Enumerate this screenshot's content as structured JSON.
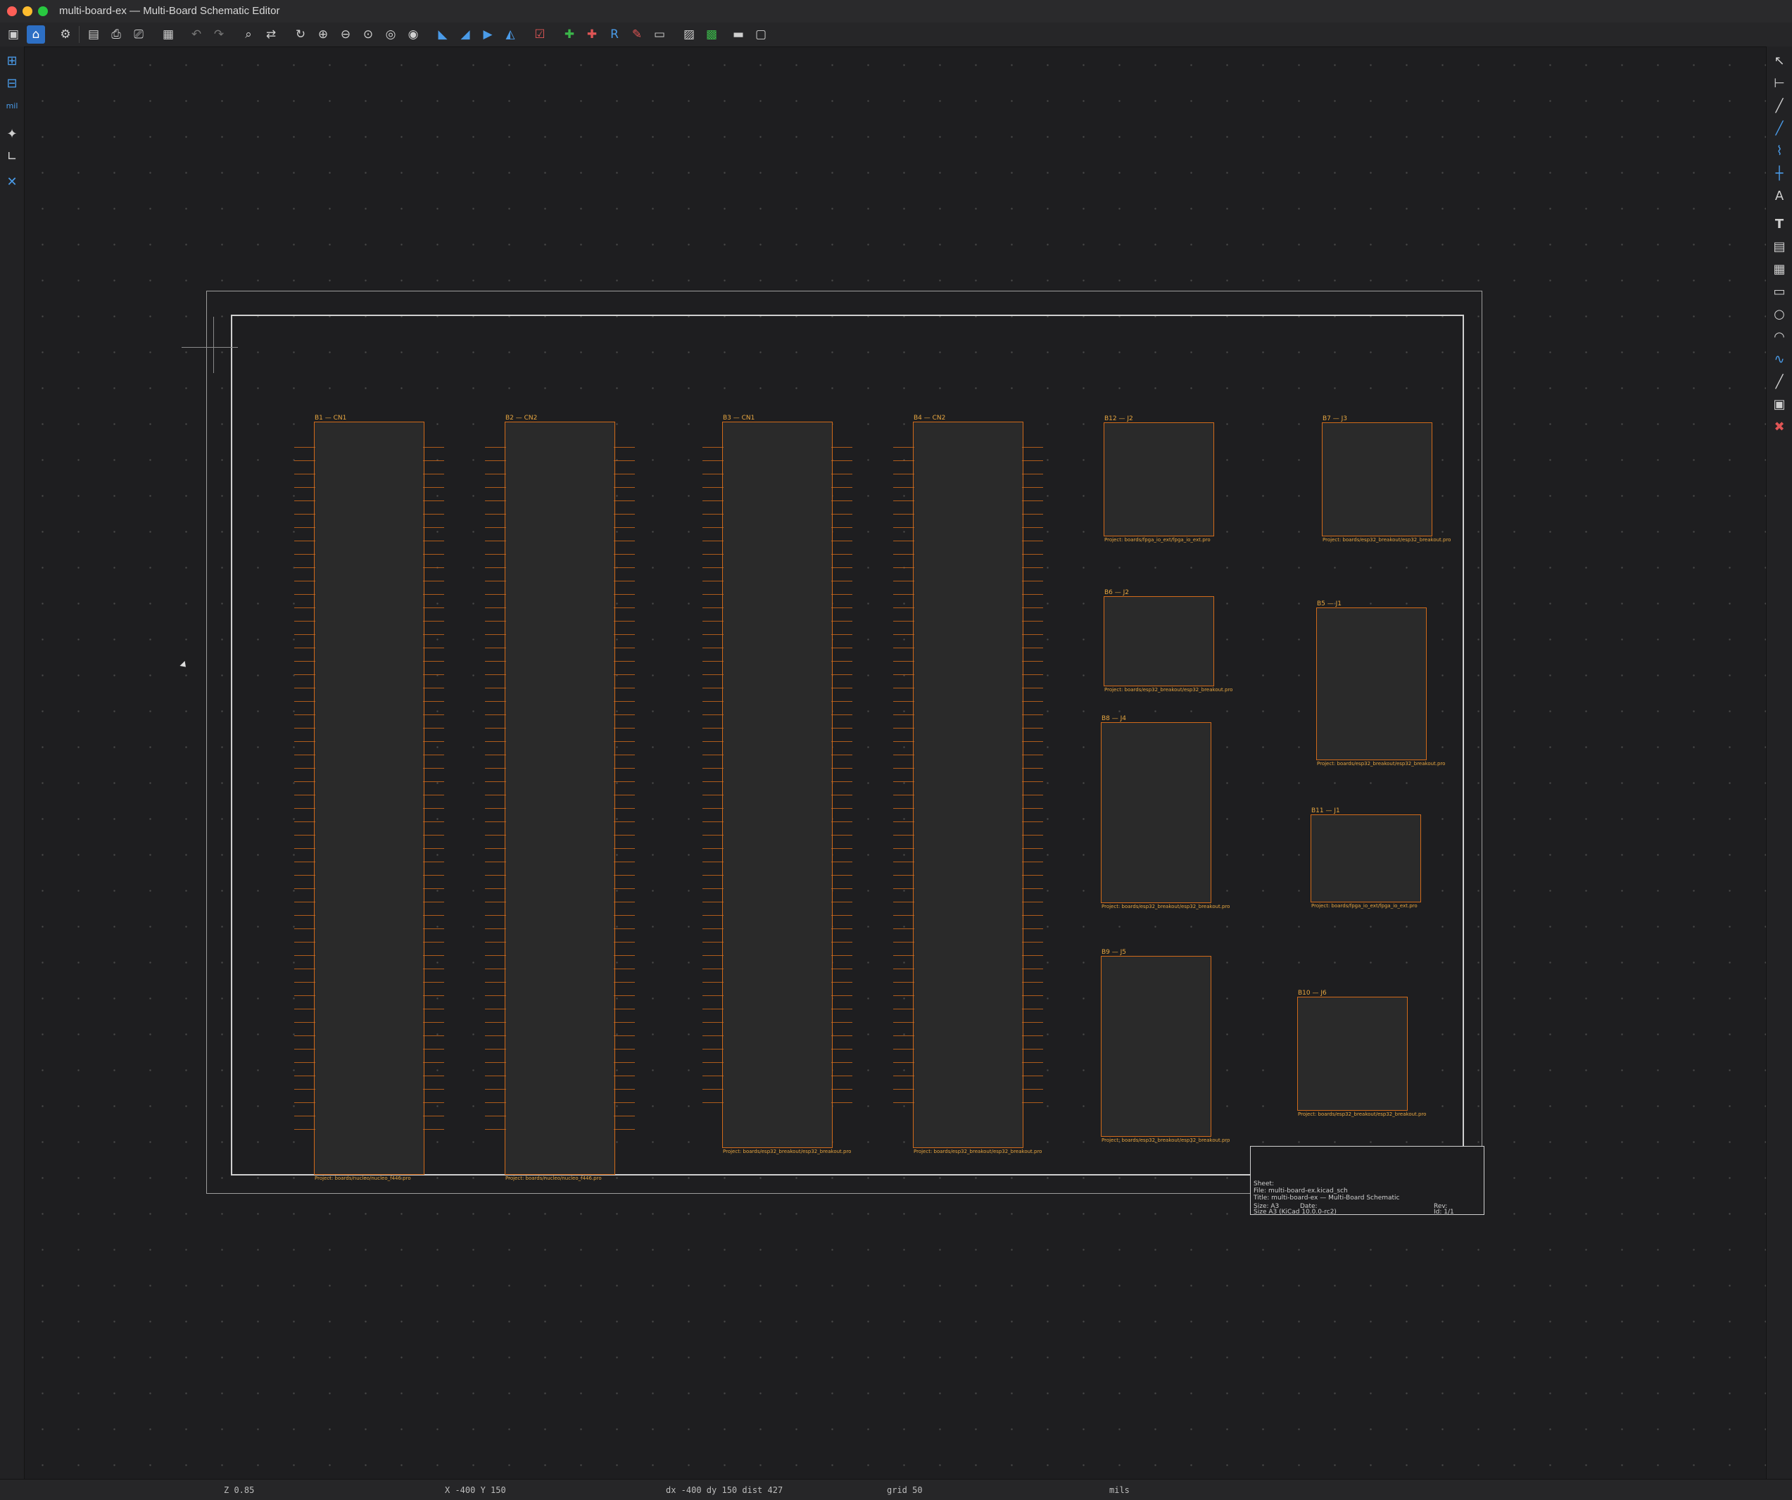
{
  "window": {
    "title": "multi-board-ex — Multi-Board Schematic Editor"
  },
  "toolbar_icons": [
    "save-icon",
    "app-icon",
    "schematic-setup-icon",
    "page-setup-icon",
    "print-icon",
    "plot-icon",
    "paste-icon",
    "undo-icon",
    "redo-icon",
    "find-icon",
    "find-replace-icon",
    "refresh-icon",
    "zoom-in-icon",
    "zoom-out-icon",
    "zoom-fit-icon",
    "zoom-objects-icon",
    "zoom-selection-icon",
    "rotate-ccw-icon",
    "rotate-cw-icon",
    "mirror-v-icon",
    "mirror-h-icon",
    "erc-icon",
    "symbol-editor-icon",
    "symbol-browser-icon",
    "annotate-icon",
    "bom-icon",
    "netlist-icon",
    "pcb-icon",
    "scripting-icon",
    "console-icon"
  ],
  "sheet": {
    "boards": [
      {
        "title": "B1 — CN1",
        "project": "Project: boards/nucleo/nucleo_f446.pro"
      },
      {
        "title": "B2 — CN2",
        "project": "Project: boards/nucleo/nucleo_f446.pro"
      },
      {
        "title": "B3 — CN1",
        "project": "Project: boards/esp32_breakout/esp32_breakout.pro"
      },
      {
        "title": "B4 — CN2",
        "project": "Project: boards/esp32_breakout/esp32_breakout.pro"
      },
      {
        "title": "B12 — J2",
        "project": "Project: boards/fpga_io_ext/fpga_io_ext.pro"
      },
      {
        "title": "B7 — J3",
        "project": "Project: boards/esp32_breakout/esp32_breakout.pro"
      },
      {
        "title": "B6 — J2",
        "project": "Project: boards/esp32_breakout/esp32_breakout.pro"
      },
      {
        "title": "B5 — J1",
        "project": "Project: boards/esp32_breakout/esp32_breakout.pro"
      },
      {
        "title": "B8 — J4",
        "project": "Project: boards/esp32_breakout/esp32_breakout.pro"
      },
      {
        "title": "B11 — J1",
        "project": "Project: boards/fpga_io_ext/fpga_io_ext.pro"
      },
      {
        "title": "B9 — J5",
        "project": "Project: boards/esp32_breakout/esp32_breakout.pro"
      },
      {
        "title": "B10 — J6",
        "project": "Project: boards/esp32_breakout/esp32_breakout.pro"
      }
    ],
    "title_block": {
      "sheet": "Sheet:",
      "file": "File: multi-board-ex.kicad_sch",
      "title": "Title: multi-board-ex — Multi-Board Schematic",
      "size": "Size: A3",
      "date": "Date:",
      "rev": "Rev:",
      "kicad": "Size A3 (KiCad 10.0.0-rc2)",
      "id": "Id: 1/1"
    }
  },
  "status": {
    "zoom": "Z 0.85",
    "coords": "X -400  Y 150",
    "delta": "dx -400  dy 150  dist 427",
    "grid": "grid 50",
    "units": "mils"
  }
}
